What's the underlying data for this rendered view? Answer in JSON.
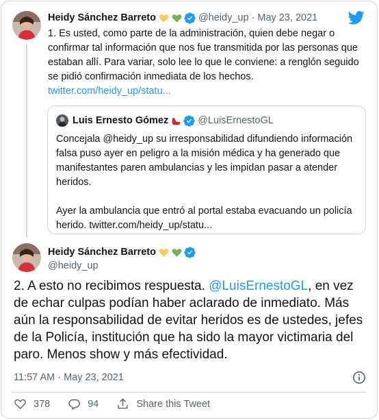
{
  "colors": {
    "link": "#1d9bf0",
    "muted": "#536471",
    "border": "#cfd9de"
  },
  "first_tweet": {
    "author_name": "Heidy Sánchez Barreto",
    "handle": "@heidy_up",
    "separator": "·",
    "date": "May 23, 2021",
    "text": "1. Es usted, como parte de la administración, quien debe negar o confirmar tal información que nos fue transmitida por las personas que estaban allí. Para variar, solo lee lo que le conviene: a renglón seguido se pidió confirmación inmediata de los hechos.",
    "link": "twitter.com/heidy_up/statu..."
  },
  "quoted_tweet": {
    "author_name": "Luis Ernesto Gómez",
    "handle": "@LuisErnestoGL",
    "paragraph1": "Concejala @heidy_up su irresponsabilidad difundiendo información falsa puso ayer en peligro a la misión médica y ha generado que manifestantes paren ambulancias y les impidan pasar a atender heridos.",
    "paragraph2": "Ayer la ambulancia que entró al portal estaba evacuando un policía herido. twitter.com/heidy_up/statu..."
  },
  "main_tweet": {
    "author_name": "Heidy Sánchez Barreto",
    "handle": "@heidy_up",
    "text_before": "2. A esto no recibimos respuesta. ",
    "mention": "@LuisErnestoGL",
    "text_after": ", en vez de echar culpas podían haber aclarado de inmediato. Más aún la responsabilidad de evitar heridos es de ustedes, jefes de la Policía, institución que ha sido la mayor victimaria del paro. Menos show y más efectividad.",
    "timestamp": "11:57 AM · May 23, 2021"
  },
  "actions": {
    "likes": "378",
    "replies": "94",
    "share_label": "Share this Tweet"
  },
  "icons": [
    "twitter-bird-icon",
    "yellow-heart-icon",
    "green-heart-icon",
    "verified-badge-icon",
    "info-icon",
    "heart-icon",
    "reply-icon",
    "share-icon",
    "red-shoe-icon"
  ]
}
